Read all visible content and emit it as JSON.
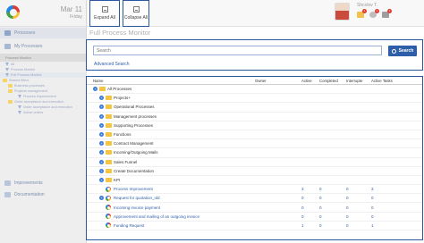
{
  "sidebar": {
    "date": "Mar 11",
    "day": "Friday",
    "nav": [
      {
        "label": "Processes"
      },
      {
        "label": "My Processes"
      }
    ],
    "section": "Process Monitor",
    "tree": [
      {
        "label": "All",
        "kind": "filter"
      },
      {
        "label": "Process Monitor",
        "kind": "filter"
      },
      {
        "label": "Full Process Monitor",
        "kind": "filter",
        "selected": true
      },
      {
        "label": "Shared filters",
        "kind": "folder"
      },
      {
        "label": "Business processes",
        "kind": "folder"
      },
      {
        "label": "Projects management",
        "kind": "folder"
      },
      {
        "label": "Process improvement",
        "kind": "filter"
      },
      {
        "label": "Order acceptance and execution",
        "kind": "folder"
      },
      {
        "label": "Order acceptance and execution",
        "kind": "filter"
      },
      {
        "label": "Active orders",
        "kind": "filter"
      }
    ],
    "bottom_nav": [
      {
        "label": "Improvements"
      },
      {
        "label": "Documentation"
      }
    ]
  },
  "toolbar": {
    "expand_all": "Expand All",
    "collapse_all": "Collapse All"
  },
  "user": {
    "name": "Shcolov T.",
    "badges": [
      "1",
      "1",
      "1"
    ]
  },
  "page": {
    "title": "Full Process Monitor"
  },
  "search": {
    "placeholder": "Search",
    "button": "Search",
    "advanced": "Advanced Search"
  },
  "table": {
    "headers": {
      "name": "Name",
      "owner": "Owner",
      "active": "Active",
      "completed": "Completed",
      "interrupted": "Interrupte",
      "tasks": "Active Tasks"
    },
    "rows": [
      {
        "name": "All Processes",
        "type": "root",
        "active": "",
        "completed": "",
        "interrupted": "",
        "tasks": ""
      },
      {
        "name": "Projects+",
        "type": "folder",
        "active": "",
        "completed": "",
        "interrupted": "",
        "tasks": ""
      },
      {
        "name": "Operational Processes",
        "type": "folder",
        "active": "",
        "completed": "",
        "interrupted": "",
        "tasks": ""
      },
      {
        "name": "Management processes",
        "type": "folder",
        "active": "",
        "completed": "",
        "interrupted": "",
        "tasks": ""
      },
      {
        "name": "Supporting Processes",
        "type": "folder",
        "active": "",
        "completed": "",
        "interrupted": "",
        "tasks": ""
      },
      {
        "name": "Functions",
        "type": "folder",
        "active": "",
        "completed": "",
        "interrupted": "",
        "tasks": ""
      },
      {
        "name": "Contract Management",
        "type": "folder",
        "active": "",
        "completed": "",
        "interrupted": "",
        "tasks": ""
      },
      {
        "name": "Incoming/Outgoing Mails",
        "type": "folder",
        "active": "",
        "completed": "",
        "interrupted": "",
        "tasks": ""
      },
      {
        "name": "Sales Funnel",
        "type": "folder",
        "active": "",
        "completed": "",
        "interrupted": "",
        "tasks": ""
      },
      {
        "name": "Create Documentation",
        "type": "folder",
        "active": "",
        "completed": "",
        "interrupted": "",
        "tasks": ""
      },
      {
        "name": "KPI",
        "type": "folder",
        "active": "",
        "completed": "",
        "interrupted": "",
        "tasks": ""
      },
      {
        "name": "Process Improvement",
        "type": "process",
        "active": "3",
        "completed": "0",
        "interrupted": "0",
        "tasks": "3"
      },
      {
        "name": "Request for quotation_old",
        "type": "process-exp",
        "active": "0",
        "completed": "0",
        "interrupted": "0",
        "tasks": "0"
      },
      {
        "name": "Incoming invoice payment",
        "type": "process",
        "active": "0",
        "completed": "0",
        "interrupted": "0",
        "tasks": "0"
      },
      {
        "name": "Approvement and mailing of an outgoing invoice",
        "type": "process",
        "active": "0",
        "completed": "0",
        "interrupted": "0",
        "tasks": "0"
      },
      {
        "name": "Funding Request",
        "type": "process",
        "active": "1",
        "completed": "0",
        "interrupted": "0",
        "tasks": "1"
      }
    ]
  },
  "colors": {
    "accent": "#2c56a0",
    "link": "#2f5ea8",
    "folder": "#f4c542"
  }
}
